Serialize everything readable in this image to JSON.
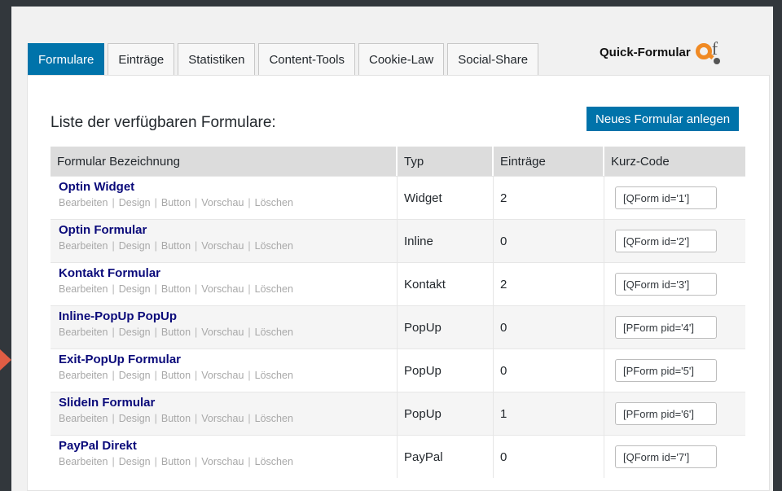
{
  "tabs": [
    {
      "label": "Formulare",
      "active": true
    },
    {
      "label": "Einträge"
    },
    {
      "label": "Statistiken"
    },
    {
      "label": "Content-Tools"
    },
    {
      "label": "Cookie-Law"
    },
    {
      "label": "Social-Share"
    }
  ],
  "brand": {
    "name": "Quick-Formular",
    "logo_letter": "f"
  },
  "page": {
    "title": "Liste der verfügbaren Formulare:",
    "new_button": "Neues Formular anlegen"
  },
  "table": {
    "headers": [
      "Formular Bezeichnung",
      "Typ",
      "Einträge",
      "Kurz-Code"
    ],
    "actions": [
      "Bearbeiten",
      "Design",
      "Button",
      "Vorschau",
      "Löschen"
    ],
    "separator": "|",
    "rows": [
      {
        "name": "Optin Widget",
        "type": "Widget",
        "entries": "2",
        "shortcode": "[QForm id='1']"
      },
      {
        "name": "Optin Formular",
        "type": "Inline",
        "entries": "0",
        "shortcode": "[QForm id='2']"
      },
      {
        "name": "Kontakt Formular",
        "type": "Kontakt",
        "entries": "2",
        "shortcode": "[QForm id='3']"
      },
      {
        "name": "Inline-PopUp PopUp",
        "type": "PopUp",
        "entries": "0",
        "shortcode": "[PForm pid='4']"
      },
      {
        "name": "Exit-PopUp Formular",
        "type": "PopUp",
        "entries": "0",
        "shortcode": "[PForm pid='5']"
      },
      {
        "name": "SlideIn Formular",
        "type": "PopUp",
        "entries": "1",
        "shortcode": "[PForm pid='6']"
      },
      {
        "name": "PayPal Direkt",
        "type": "PayPal",
        "entries": "0",
        "shortcode": "[QForm id='7']"
      }
    ]
  },
  "colors": {
    "accent": "#0073aa",
    "logo_orange": "#f08a24",
    "link": "#0a0a7a"
  }
}
